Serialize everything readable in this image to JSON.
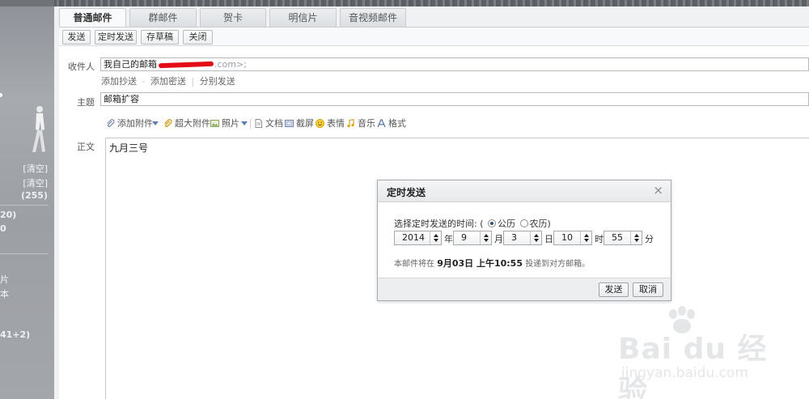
{
  "sidebar": {
    "rows": [
      {
        "text": "[清空]"
      },
      {
        "text": "[清空]"
      },
      {
        "text": "(255)"
      },
      {
        "text": "20)"
      },
      {
        "text": "0"
      },
      {
        "text": "片"
      },
      {
        "text": "本"
      },
      {
        "text": "41+2)"
      }
    ]
  },
  "tabs": [
    "普通邮件",
    "群邮件",
    "贺卡",
    "明信片",
    "音视频邮件"
  ],
  "toolbar": {
    "send": "发送",
    "scheduled_send": "定时发送",
    "save_draft": "存草稿",
    "close": "关闭"
  },
  "compose": {
    "to_label": "收件人",
    "to_value_prefix": "我自己的邮箱",
    "to_value_suffix": ".com>;",
    "links": {
      "add_cc": "添加抄送",
      "separator": "-",
      "add_bcc": "添加密送",
      "pipe": "|",
      "send_separately": "分别发送"
    },
    "subject_label": "主题",
    "subject_value": "邮箱扩容",
    "attachments": {
      "add_attachment": "添加附件",
      "large_attachment": "超大附件",
      "photo": "照片",
      "document": "文档",
      "screenshot": "截屏",
      "emoji": "表情",
      "music": "音乐",
      "format": "格式"
    },
    "body_label": "正文",
    "body_text": "九月三号"
  },
  "dialog": {
    "title": "定时发送",
    "close_glyph": "×",
    "prompt": "选择定时发送的时间:",
    "paren_open": "(",
    "paren_close": ")",
    "calendar_gregorian": "公历",
    "calendar_lunar": "农历",
    "calendar_selected": "gregorian",
    "year": "2014",
    "year_unit": "年",
    "month": "9",
    "month_unit": "月",
    "day": "3",
    "day_unit": "日",
    "hour": "10",
    "hour_unit": "时",
    "minute": "55",
    "minute_unit": "分",
    "note_prefix": "本邮件将在",
    "note_time": "9月03日 上午10:55",
    "note_suffix": "投递到对方邮箱。",
    "send_button": "发送",
    "cancel_button": "取消"
  },
  "watermark": {
    "brand": "Bai du 经验",
    "url": "jingyan.baidu.com"
  },
  "colors": {
    "redaction": "#e40d17",
    "radio_selected": "#2a4d8f",
    "dropdown_arrow": "#5a7dbb"
  }
}
